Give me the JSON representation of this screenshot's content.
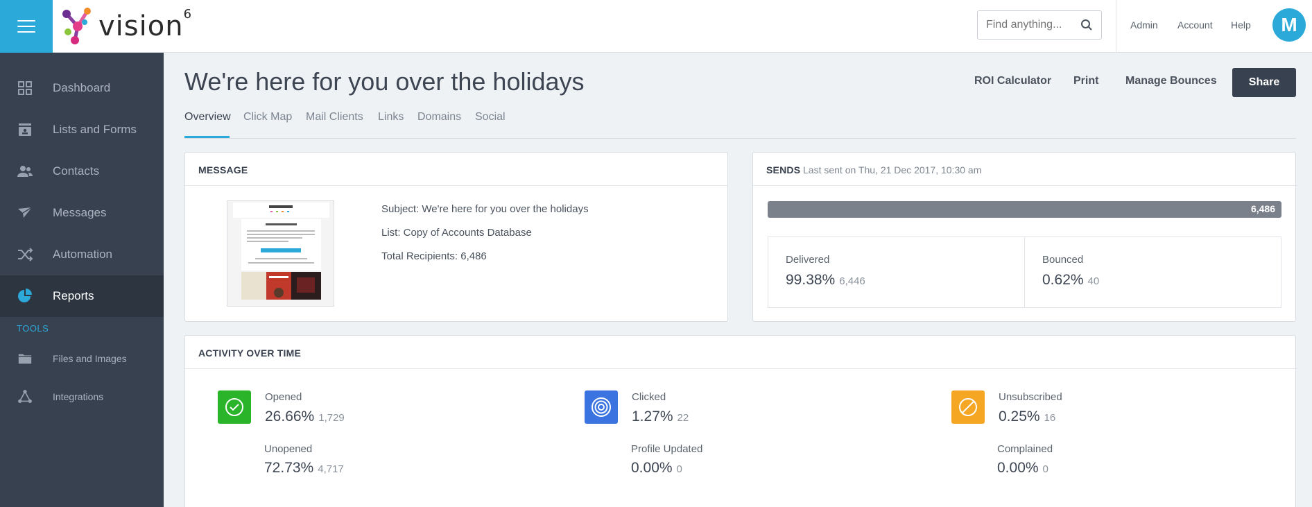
{
  "header": {
    "logo_text": "vision",
    "logo_sup": "6",
    "search_placeholder": "Find anything...",
    "links": [
      "Admin",
      "Account",
      "Help"
    ],
    "avatar_initial": "M"
  },
  "sidebar": {
    "items": [
      {
        "label": "Dashboard",
        "icon": "grid-icon"
      },
      {
        "label": "Lists and Forms",
        "icon": "list-icon"
      },
      {
        "label": "Contacts",
        "icon": "contacts-icon"
      },
      {
        "label": "Messages",
        "icon": "paper-plane-icon"
      },
      {
        "label": "Automation",
        "icon": "shuffle-icon"
      },
      {
        "label": "Reports",
        "icon": "pie-chart-icon",
        "active": true
      }
    ],
    "tools_label": "TOOLS",
    "tools": [
      {
        "label": "Files and Images",
        "icon": "folder-icon"
      },
      {
        "label": "Integrations",
        "icon": "integrations-icon"
      }
    ]
  },
  "page": {
    "title": "We're here for you over the holidays",
    "actions": [
      "ROI Calculator",
      "Print",
      "Manage Bounces"
    ],
    "share_label": "Share",
    "tabs": [
      "Overview",
      "Click Map",
      "Mail Clients",
      "Links",
      "Domains",
      "Social"
    ],
    "active_tab": "Overview"
  },
  "message": {
    "title": "MESSAGE",
    "subject": "Subject: We're here for you over the holidays",
    "list": "List: Copy of Accounts Database",
    "recipients": "Total Recipients: 6,486"
  },
  "sends": {
    "title": "SENDS",
    "last_sent": "Last sent on Thu, 21 Dec 2017, 10:30 am",
    "bar_value": "6,486",
    "bar_fraction": 1.0,
    "delivered": {
      "label": "Delivered",
      "pct": "99.38%",
      "count": "6,446"
    },
    "bounced": {
      "label": "Bounced",
      "pct": "0.62%",
      "count": "40"
    }
  },
  "activity": {
    "title": "ACTIVITY OVER TIME",
    "opened": {
      "label": "Opened",
      "pct": "26.66%",
      "count": "1,729",
      "color": "#2ab42a"
    },
    "unopened": {
      "label": "Unopened",
      "pct": "72.73%",
      "count": "4,717"
    },
    "clicked": {
      "label": "Clicked",
      "pct": "1.27%",
      "count": "22",
      "color": "#3b74e0"
    },
    "profile_updated": {
      "label": "Profile Updated",
      "pct": "0.00%",
      "count": "0"
    },
    "unsubscribed": {
      "label": "Unsubscribed",
      "pct": "0.25%",
      "count": "16",
      "color": "#f5a623"
    },
    "complained": {
      "label": "Complained",
      "pct": "0.00%",
      "count": "0"
    }
  },
  "colors": {
    "accent": "#2ba9d9",
    "sidebar": "#38414f",
    "share_button": "#38414f"
  }
}
